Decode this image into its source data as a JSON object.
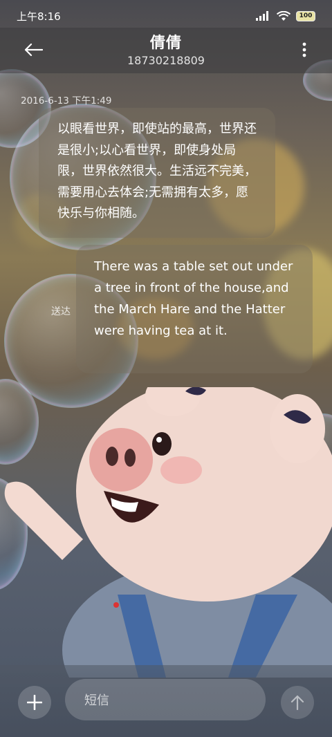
{
  "status_bar": {
    "time": "上午8:16",
    "battery": "100"
  },
  "header": {
    "contact_name": "倩倩",
    "contact_number": "18730218809"
  },
  "conversation": {
    "timestamp": "2016-6-13 下午1:49",
    "incoming_message": "以眼看世界，即使站的最高，世界还是很小;以心看世界，即使身处局限，世界依然很大。生活远不完美，需要用心去体会;无需拥有太多，愿快乐与你相随。",
    "outgoing_message": "There was a table set out under a tree in front of the house,and the March Hare and the Hatter were having tea at it.",
    "outgoing_status": "送达"
  },
  "composer": {
    "placeholder": "短信"
  },
  "icons": {
    "back": "arrow-left-icon",
    "more": "more-vertical-icon",
    "add": "plus-icon",
    "send": "arrow-up-icon",
    "signal": "signal-icon",
    "wifi": "wifi-icon",
    "battery": "battery-icon"
  }
}
